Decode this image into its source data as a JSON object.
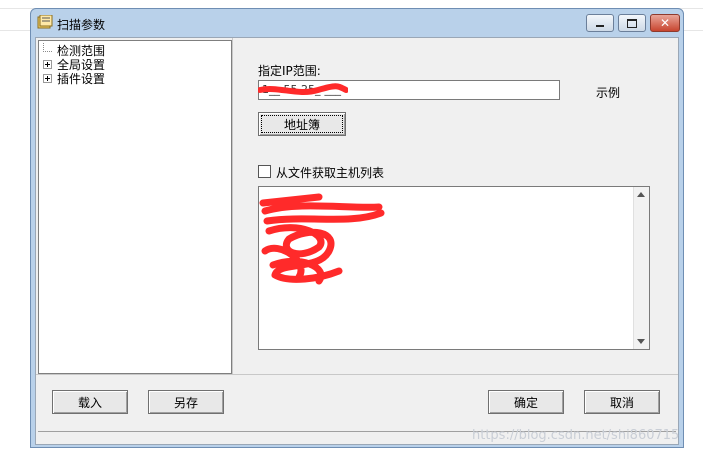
{
  "window": {
    "title": "扫描参数"
  },
  "tree": {
    "items": [
      {
        "label": "检测范围",
        "expandable": false
      },
      {
        "label": "全局设置",
        "expandable": true
      },
      {
        "label": "插件设置",
        "expandable": true
      }
    ]
  },
  "form": {
    "ip_range_label": "指定IP范围:",
    "ip_value": "1__.55.25_-___",
    "example_label": "示例",
    "address_book_button": "地址簿",
    "from_file_checkbox": {
      "label": "从文件获取主机列表",
      "checked": false
    }
  },
  "footer": {
    "load_button": "载入",
    "save_as_button": "另存",
    "ok_button": "确定",
    "cancel_button": "取消"
  },
  "watermark": "https://blog.csdn.net/shi860715",
  "colors": {
    "window_frame": "#b9d1ea",
    "scribble": "#ff2a2a",
    "close_button": "#c8452f"
  }
}
